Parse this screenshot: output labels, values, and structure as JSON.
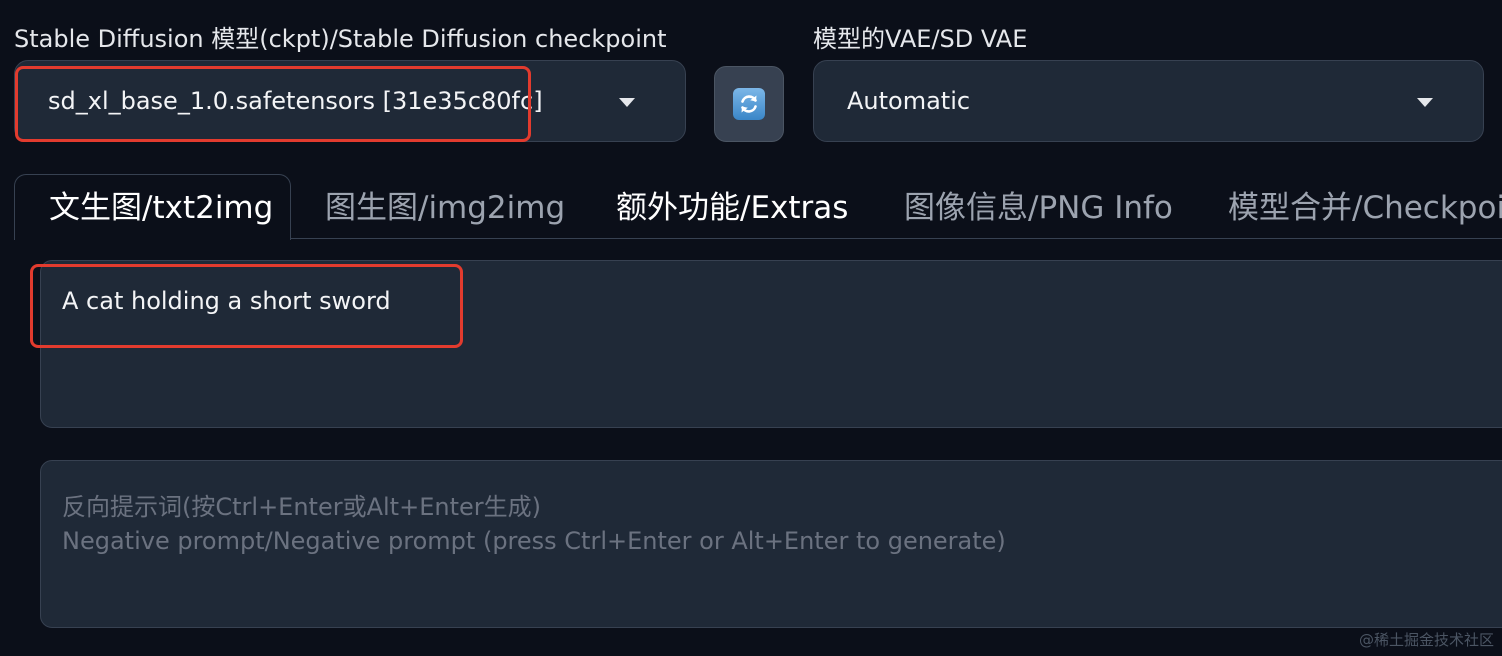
{
  "checkpoint": {
    "label": "Stable Diffusion 模型(ckpt)/Stable Diffusion checkpoint",
    "value": "sd_xl_base_1.0.safetensors [31e35c80fc]"
  },
  "refresh_button": {
    "icon": "refresh-icon"
  },
  "vae": {
    "label": "模型的VAE/SD VAE",
    "value": "Automatic"
  },
  "tabs": [
    {
      "label": "文生图/txt2img",
      "selected": true
    },
    {
      "label": "图生图/img2img",
      "selected": false
    },
    {
      "label": "额外功能/Extras",
      "selected": false
    },
    {
      "label": "图像信息/PNG Info",
      "selected": false
    },
    {
      "label": "模型合并/Checkpoint",
      "selected": false
    }
  ],
  "prompt": {
    "value": "A cat holding a short sword"
  },
  "negative_prompt": {
    "placeholder_line1": "反向提示词(按Ctrl+Enter或Alt+Enter生成)",
    "placeholder_line2": "Negative prompt/Negative prompt (press Ctrl+Enter or Alt+Enter to generate)"
  },
  "watermark": "@稀土掘金技术社区",
  "colors": {
    "background": "#0b0f19",
    "input_background": "#1f2937",
    "border": "#374151",
    "highlight": "#e23b2e"
  }
}
